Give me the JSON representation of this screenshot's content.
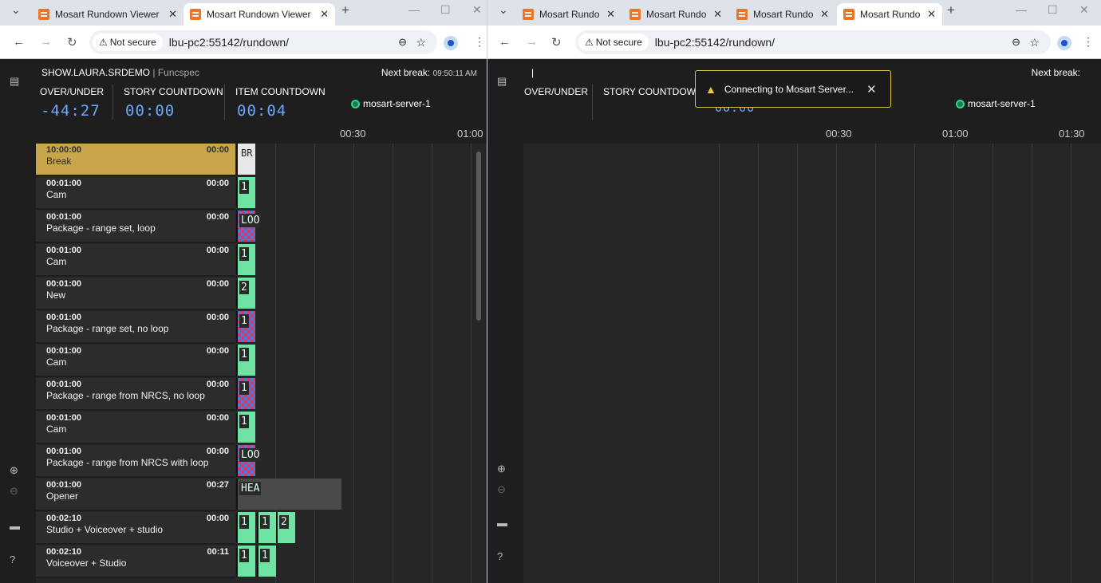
{
  "window1": {
    "tabs": [
      {
        "title": "Mosart Rundown Viewer",
        "active": false
      },
      {
        "title": "Mosart Rundown Viewer",
        "active": true
      }
    ],
    "url": {
      "security": "Not secure",
      "address": "lbu-pc2:55142/rundown/"
    },
    "app": {
      "show_name": "SHOW.LAURA.SRDEMO",
      "show_sep": "|",
      "show_sub": "Funcspec",
      "next_break_label": "Next break:",
      "next_break_time": "09:50:11 AM",
      "over_under_label": "OVER/UNDER",
      "over_under_value": "-44:27",
      "story_cd_label": "STORY COUNTDOWN",
      "story_cd_value": "00:00",
      "item_cd_label": "ITEM COUNTDOWN",
      "item_cd_value": "00:04",
      "server": "mosart-server-1",
      "ruler": [
        "00:30",
        "01:00"
      ]
    },
    "rows": [
      {
        "time": "10:00:00",
        "name": "Break",
        "count": "00:00",
        "type": "break"
      },
      {
        "time": "00:01:00",
        "name": "Cam",
        "count": "00:00"
      },
      {
        "time": "00:01:00",
        "name": "Package - range set, loop",
        "count": "00:00"
      },
      {
        "time": "00:01:00",
        "name": "Cam",
        "count": "00:00"
      },
      {
        "time": "00:01:00",
        "name": "New",
        "count": "00:00"
      },
      {
        "time": "00:01:00",
        "name": "Package - range set, no loop",
        "count": "00:00"
      },
      {
        "time": "00:01:00",
        "name": "Cam",
        "count": "00:00"
      },
      {
        "time": "00:01:00",
        "name": "Package - range from NRCS, no loop",
        "count": "00:00"
      },
      {
        "time": "00:01:00",
        "name": "Cam",
        "count": "00:00"
      },
      {
        "time": "00:01:00",
        "name": "Package - range from NRCS with loop",
        "count": "00:00"
      },
      {
        "time": "00:01:00",
        "name": "Opener",
        "count": "00:27"
      },
      {
        "time": "00:02:10",
        "name": "Studio + Voiceover + studio",
        "count": "00:00"
      },
      {
        "time": "00:02:10",
        "name": "Voiceover + Studio",
        "count": "00:11"
      }
    ],
    "blocks": [
      "BR",
      "1",
      "LOO",
      "1",
      "2",
      "1",
      "1",
      "1",
      "1",
      "LOO",
      "HEA",
      "1",
      "1",
      "2",
      "1",
      "1"
    ]
  },
  "window2": {
    "tabs": [
      {
        "title": "Mosart Rundo",
        "active": false
      },
      {
        "title": "Mosart Rundo",
        "active": false
      },
      {
        "title": "Mosart Rundo",
        "active": false
      },
      {
        "title": "Mosart Rundo",
        "active": true
      }
    ],
    "url": {
      "security": "Not secure",
      "address": "lbu-pc2:55142/rundown/"
    },
    "app": {
      "show_sep": "|",
      "next_break_label": "Next break:",
      "over_under_label": "OVER/UNDER",
      "story_cd_label": "STORY COUNTDOWN",
      "item_cd_value": "00:00",
      "server": "mosart-server-1",
      "ruler": [
        "00:30",
        "01:00",
        "01:30"
      ]
    },
    "toast": {
      "message": "Connecting to Mosart Server..."
    }
  }
}
